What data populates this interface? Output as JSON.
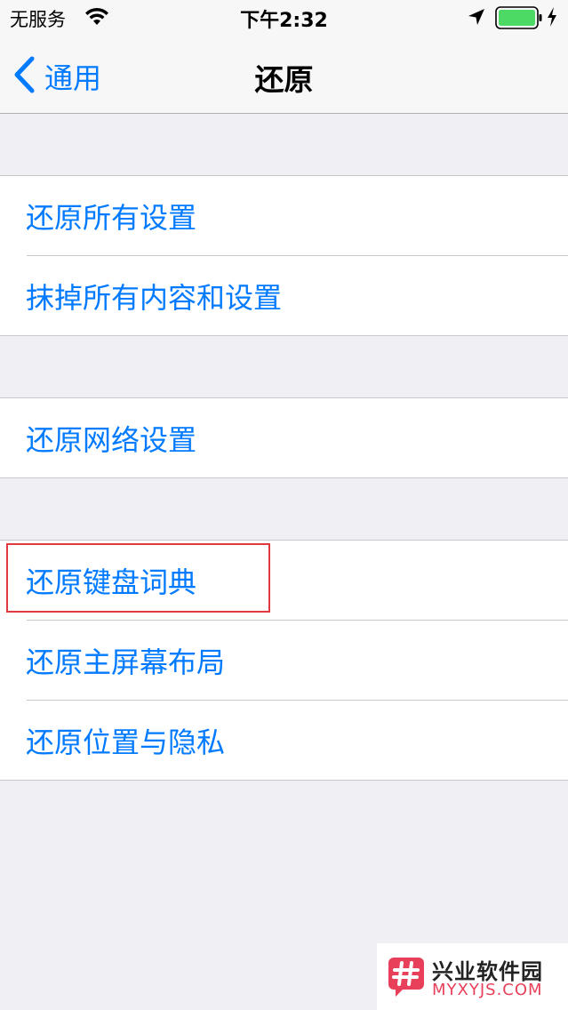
{
  "status_bar": {
    "carrier": "无服务",
    "time": "下午2:32",
    "wifi_icon": "wifi-icon",
    "location_icon": "location-arrow-icon",
    "battery_icon": "battery-full-icon",
    "charging_icon": "charging-bolt-icon",
    "battery_color": "#4cd964"
  },
  "nav": {
    "back_label": "通用",
    "back_icon": "chevron-left-icon",
    "title": "还原"
  },
  "groups": [
    {
      "items": [
        {
          "label": "还原所有设置"
        },
        {
          "label": "抹掉所有内容和设置"
        }
      ]
    },
    {
      "items": [
        {
          "label": "还原网络设置"
        }
      ]
    },
    {
      "items": [
        {
          "label": "还原键盘词典",
          "highlighted": true
        },
        {
          "label": "还原主屏幕布局"
        },
        {
          "label": "还原位置与隐私"
        }
      ]
    }
  ],
  "colors": {
    "accent": "#007aff",
    "background": "#efeff4",
    "highlight_border": "#e0393e"
  },
  "watermark": {
    "name": "兴业软件园",
    "url": "MYXYJS.COM"
  }
}
